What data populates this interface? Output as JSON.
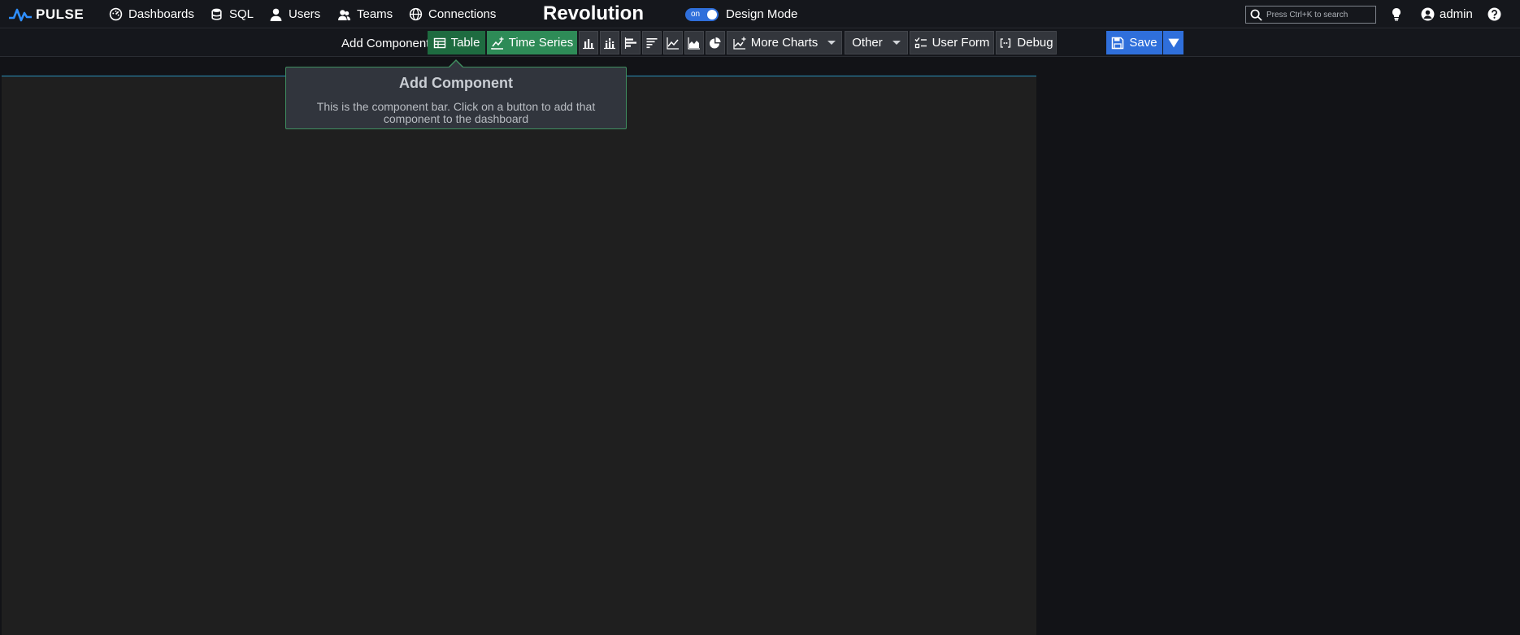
{
  "brand": {
    "name": "PULSE"
  },
  "nav": [
    {
      "label": "Dashboards",
      "icon": "dashboard-icon"
    },
    {
      "label": "SQL",
      "icon": "database-icon"
    },
    {
      "label": "Users",
      "icon": "user-icon"
    },
    {
      "label": "Teams",
      "icon": "teams-icon"
    },
    {
      "label": "Connections",
      "icon": "globe-icon"
    }
  ],
  "app_title": "Revolution",
  "design_mode": {
    "toggle_label": "on",
    "label": "Design Mode",
    "on": true
  },
  "search": {
    "placeholder": "Press Ctrl+K to search"
  },
  "user": {
    "name": "admin"
  },
  "component_bar": {
    "label": "Add Component:",
    "table": "Table",
    "time_series": "Time Series",
    "more_charts": "More Charts",
    "other": "Other",
    "user_form": "User Form",
    "debug": "Debug",
    "save": "Save"
  },
  "tooltip": {
    "title": "Add Component",
    "text": "This is the component bar. Click on a button to add that component to the dashboard"
  },
  "colors": {
    "accent_blue": "#2f6fdb",
    "accent_green": "#2e8b57",
    "canvas": "#1f1f1f",
    "background": "#121317"
  }
}
